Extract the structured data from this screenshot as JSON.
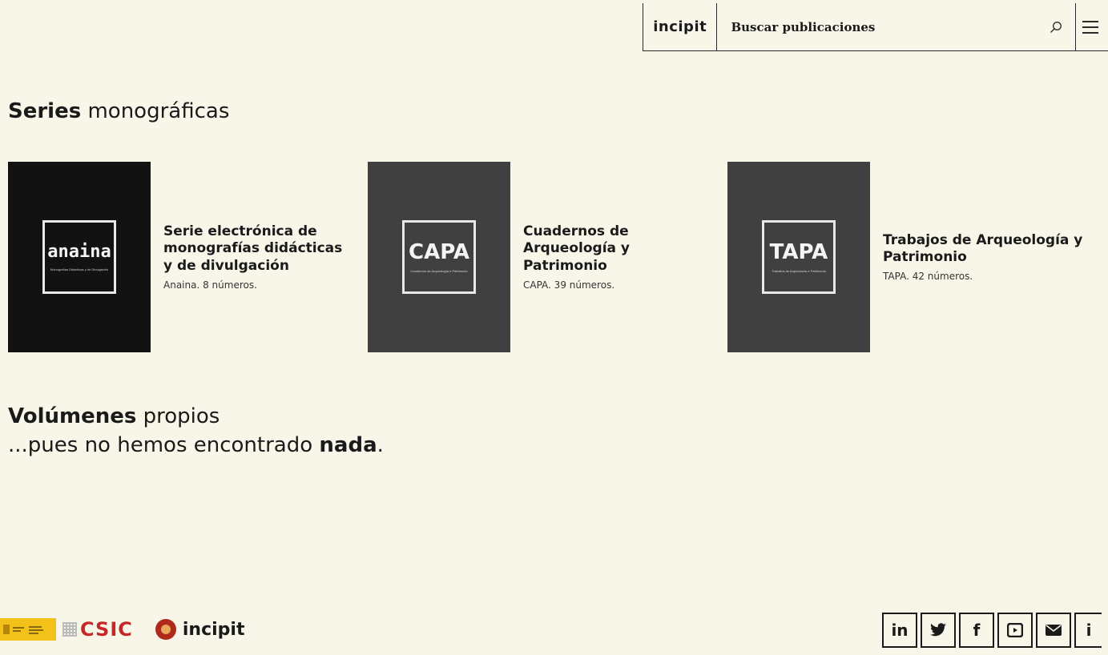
{
  "header": {
    "brand": "incipit",
    "search_placeholder": "Buscar publicaciones",
    "search_icon": "search-icon",
    "menu_icon": "hamburger-menu-icon"
  },
  "series_section": {
    "heading_bold": "Series",
    "heading_rest": " monográficas",
    "items": [
      {
        "cover_label": "anaina",
        "cover_sub": "Monografías Didácticas y de Divulgación",
        "cover_color": "#121212",
        "title": "Serie electrónica de monografías didácticas y de divulgación",
        "meta": "Anaina. 8 números."
      },
      {
        "cover_label": "CAPA",
        "cover_sub": "Cuadernos de Arqueología e Patrimonio",
        "cover_color": "#404040",
        "title": "Cuadernos de Arqueología y Patrimonio",
        "meta": "CAPA. 39 números."
      },
      {
        "cover_label": "TAPA",
        "cover_sub": "Traballos de Arqueoloxía e Patrimonio",
        "cover_color": "#404040",
        "title": "Trabajos de Arqueología y Patrimonio",
        "meta": "TAPA. 42 números."
      }
    ]
  },
  "volumes_section": {
    "heading_bold": "Volúmenes",
    "heading_rest": " propios",
    "empty_prefix": "...pues no hemos encontrado ",
    "empty_bold": "nada",
    "empty_suffix": "."
  },
  "footer": {
    "csic_label": "CSIC",
    "incipit_label": "incipit",
    "social": [
      {
        "icon": "linkedin-icon",
        "glyph": "in"
      },
      {
        "icon": "twitter-icon",
        "glyph": "🐦"
      },
      {
        "icon": "facebook-icon",
        "glyph": "f"
      },
      {
        "icon": "youtube-icon",
        "glyph": "▣"
      },
      {
        "icon": "email-icon",
        "glyph": "✉"
      },
      {
        "icon": "info-icon",
        "glyph": "i"
      }
    ]
  }
}
